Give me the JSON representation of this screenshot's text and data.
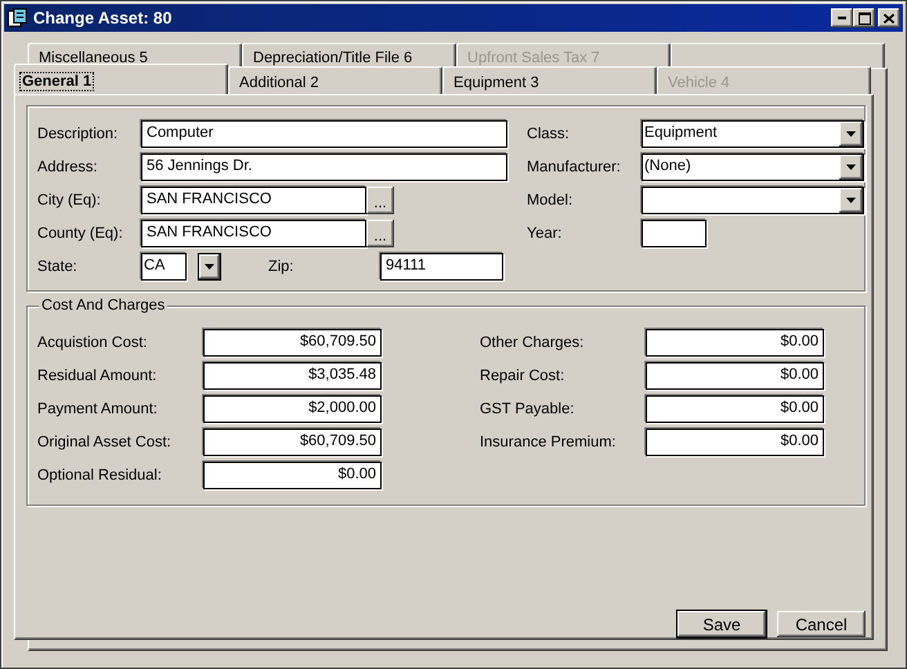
{
  "window": {
    "title": "Change Asset: 80"
  },
  "tabs": {
    "back_row": [
      {
        "label": "Miscellaneous 5",
        "selected": false,
        "disabled": false
      },
      {
        "label": "Depreciation/Title File 6",
        "selected": false,
        "disabled": false
      },
      {
        "label": "Upfront Sales Tax 7",
        "selected": false,
        "disabled": true
      }
    ],
    "front_row": [
      {
        "label": "General 1",
        "selected": true,
        "disabled": false
      },
      {
        "label": "Additional 2",
        "selected": false,
        "disabled": false
      },
      {
        "label": "Equipment 3",
        "selected": false,
        "disabled": false
      },
      {
        "label": "Vehicle 4",
        "selected": false,
        "disabled": true
      }
    ]
  },
  "general": {
    "left": [
      {
        "kind": "text",
        "label": "Description:",
        "value": "Computer"
      },
      {
        "kind": "text",
        "label": "Address:",
        "value": "56 Jennings Dr."
      },
      {
        "kind": "browse",
        "label": "City (Eq):",
        "value": "SAN FRANCISCO",
        "button": "..."
      },
      {
        "kind": "browse",
        "label": "County (Eq):",
        "value": "SAN FRANCISCO",
        "button": "..."
      }
    ],
    "state": {
      "label": "State:",
      "value": "CA"
    },
    "zip": {
      "label": "Zip:",
      "value": "94111"
    },
    "right": [
      {
        "kind": "combo",
        "label": "Class:",
        "value": "Equipment"
      },
      {
        "kind": "combo",
        "label": "Manufacturer:",
        "value": "(None)"
      },
      {
        "kind": "combo",
        "label": "Model:"
      },
      {
        "kind": "short",
        "label": "Year:"
      }
    ]
  },
  "cost_and_charges": {
    "title": "Cost And Charges",
    "left": [
      {
        "label": "Acquistion Cost:",
        "value": "$60,709.50"
      },
      {
        "label": "Residual Amount:",
        "value": "$3,035.48"
      },
      {
        "label": "Payment Amount:",
        "value": "$2,000.00"
      },
      {
        "label": "Original Asset Cost:",
        "value": "$60,709.50"
      },
      {
        "label": "Optional Residual:",
        "value": "$0.00"
      }
    ],
    "right": [
      {
        "label": "Other Charges:",
        "value": "$0.00"
      },
      {
        "label": "Repair Cost:",
        "value": "$0.00"
      },
      {
        "label": "GST Payable:",
        "value": "$0.00"
      },
      {
        "label": "Insurance Premium:",
        "value": "$0.00"
      }
    ]
  },
  "buttons": [
    {
      "label": "Save",
      "default": true
    },
    {
      "label": "Cancel",
      "default": false
    }
  ]
}
